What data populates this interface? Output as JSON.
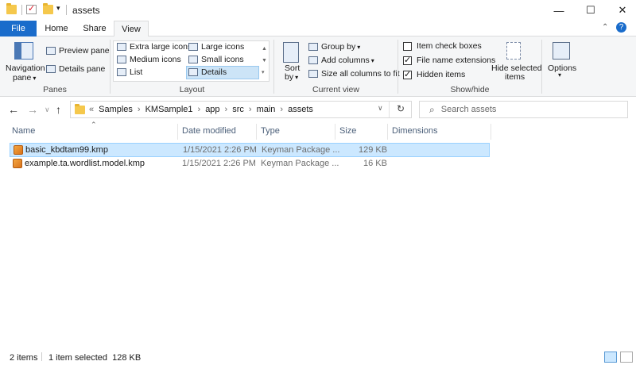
{
  "window": {
    "title": "assets"
  },
  "window_controls": {
    "minimize": "—",
    "maximize": "☐",
    "close": "✕"
  },
  "tabs": [
    {
      "label": "File"
    },
    {
      "label": "Home"
    },
    {
      "label": "Share"
    },
    {
      "label": "View"
    }
  ],
  "ribbon": {
    "panes": {
      "group_label": "Panes",
      "navigation_pane": "Navigation",
      "navigation_pane_2": "pane",
      "preview_pane": "Preview pane",
      "details_pane": "Details pane"
    },
    "layout": {
      "group_label": "Layout",
      "items": [
        "Extra large icons",
        "Large icons",
        "Medium icons",
        "Small icons",
        "List",
        "Details"
      ]
    },
    "current_view": {
      "group_label": "Current view",
      "sort_by": "Sort",
      "sort_by_2": "by",
      "group_by": "Group by",
      "add_columns": "Add columns",
      "size_all_columns": "Size all columns to fit"
    },
    "show_hide": {
      "group_label": "Show/hide",
      "item_check_boxes": "Item check boxes",
      "file_name_extensions": "File name extensions",
      "hidden_items": "Hidden items",
      "hide_selected": "Hide selected",
      "hide_selected_2": "items"
    },
    "options": {
      "label": "Options"
    }
  },
  "address": {
    "prefix": "«",
    "breadcrumbs": [
      "Samples",
      "KMSample1",
      "app",
      "src",
      "main",
      "assets"
    ],
    "search_placeholder": "Search assets"
  },
  "columns": [
    "Name",
    "Date modified",
    "Type",
    "Size",
    "Dimensions"
  ],
  "files": [
    {
      "name": "basic_kbdtam99.kmp",
      "date": "1/15/2021 2:26 PM",
      "type": "Keyman Package ...",
      "size": "129 KB",
      "selected": true
    },
    {
      "name": "example.ta.wordlist.model.kmp",
      "date": "1/15/2021 2:26 PM",
      "type": "Keyman Package ...",
      "size": "16 KB",
      "selected": false
    }
  ],
  "status": {
    "items": "2 items",
    "selected": "1 item selected  128 KB"
  },
  "colors": {
    "accent": "#1a6ccb",
    "selection": "#cce8ff"
  }
}
